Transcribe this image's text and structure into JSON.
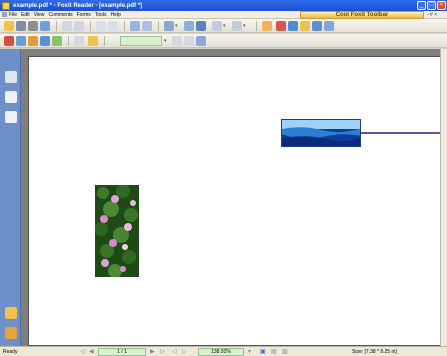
{
  "window": {
    "title": "example.pdf * - Foxit Reader - [example.pdf *]",
    "minimize_glyph": "_",
    "maximize_glyph": "□",
    "close_glyph": "×"
  },
  "menu": {
    "items": [
      "File",
      "Edit",
      "View",
      "Comments",
      "Forms",
      "Tools",
      "Help"
    ],
    "cool_toolbar_label": "Cool Foxit Toolbar",
    "extra": "- # ×"
  },
  "statusbar": {
    "status": "Ready",
    "page_indicator": "1 / 1",
    "zoom": "138.92%",
    "page_size": "Size: [7.38 * 9.25 in]"
  },
  "colors": {
    "titlebar": "#1b4fd0",
    "sidepanel": "#6d90c8",
    "annotation_line": "#6b4d9a"
  }
}
